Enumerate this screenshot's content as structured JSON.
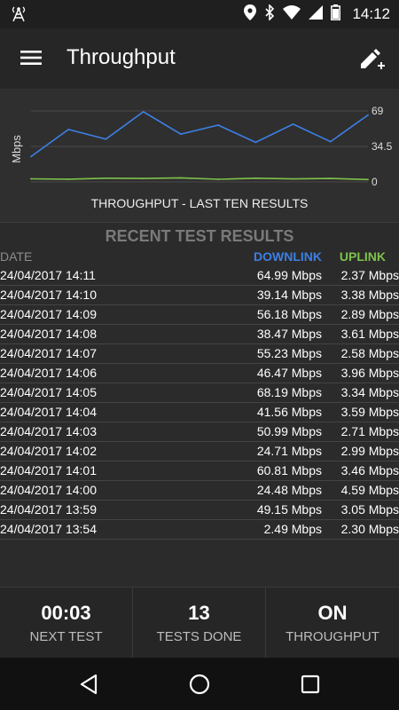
{
  "status_bar": {
    "time": "14:12"
  },
  "app_bar": {
    "title": "Throughput",
    "menu_icon": "menu-icon",
    "action_icon": "edit-add-icon"
  },
  "chart_data": {
    "type": "line",
    "title": "THROUGHPUT - LAST TEN RESULTS",
    "ylabel": "Mbps",
    "yticks": [
      "69",
      "34.5",
      "0"
    ],
    "ylim": [
      0,
      69
    ],
    "series": [
      {
        "name": "Downlink",
        "color": "#3d7fe6",
        "values": [
          24.71,
          50.99,
          41.56,
          68.19,
          46.47,
          55.23,
          38.47,
          56.18,
          39.14,
          64.99
        ]
      },
      {
        "name": "Uplink",
        "color": "#7ec24b",
        "values": [
          2.99,
          2.71,
          3.59,
          3.34,
          3.96,
          2.58,
          3.61,
          2.89,
          3.38,
          2.37
        ]
      }
    ]
  },
  "results": {
    "heading": "RECENT TEST RESULTS",
    "columns": {
      "date": "DATE",
      "downlink": "DOWNLINK",
      "uplink": "UPLINK"
    },
    "rows": [
      {
        "date": "24/04/2017 14:11",
        "downlink": "64.99 Mbps",
        "uplink": "2.37 Mbps"
      },
      {
        "date": "24/04/2017 14:10",
        "downlink": "39.14 Mbps",
        "uplink": "3.38 Mbps"
      },
      {
        "date": "24/04/2017 14:09",
        "downlink": "56.18 Mbps",
        "uplink": "2.89 Mbps"
      },
      {
        "date": "24/04/2017 14:08",
        "downlink": "38.47 Mbps",
        "uplink": "3.61 Mbps"
      },
      {
        "date": "24/04/2017 14:07",
        "downlink": "55.23 Mbps",
        "uplink": "2.58 Mbps"
      },
      {
        "date": "24/04/2017 14:06",
        "downlink": "46.47 Mbps",
        "uplink": "3.96 Mbps"
      },
      {
        "date": "24/04/2017 14:05",
        "downlink": "68.19 Mbps",
        "uplink": "3.34 Mbps"
      },
      {
        "date": "24/04/2017 14:04",
        "downlink": "41.56 Mbps",
        "uplink": "3.59 Mbps"
      },
      {
        "date": "24/04/2017 14:03",
        "downlink": "50.99 Mbps",
        "uplink": "2.71 Mbps"
      },
      {
        "date": "24/04/2017 14:02",
        "downlink": "24.71 Mbps",
        "uplink": "2.99 Mbps"
      },
      {
        "date": "24/04/2017 14:01",
        "downlink": "60.81 Mbps",
        "uplink": "3.46 Mbps"
      },
      {
        "date": "24/04/2017 14:00",
        "downlink": "24.48 Mbps",
        "uplink": "4.59 Mbps"
      },
      {
        "date": "24/04/2017 13:59",
        "downlink": "49.15 Mbps",
        "uplink": "3.05 Mbps"
      },
      {
        "date": "24/04/2017 13:54",
        "downlink": "2.49 Mbps",
        "uplink": "2.30 Mbps"
      }
    ]
  },
  "stats": {
    "next_test": {
      "value": "00:03",
      "label": "NEXT TEST"
    },
    "tests_done": {
      "value": "13",
      "label": "TESTS DONE"
    },
    "throughput": {
      "value": "ON",
      "label": "THROUGHPUT"
    }
  },
  "colors": {
    "downlink": "#3d7fe6",
    "uplink": "#7ec24b",
    "background": "#262626"
  }
}
